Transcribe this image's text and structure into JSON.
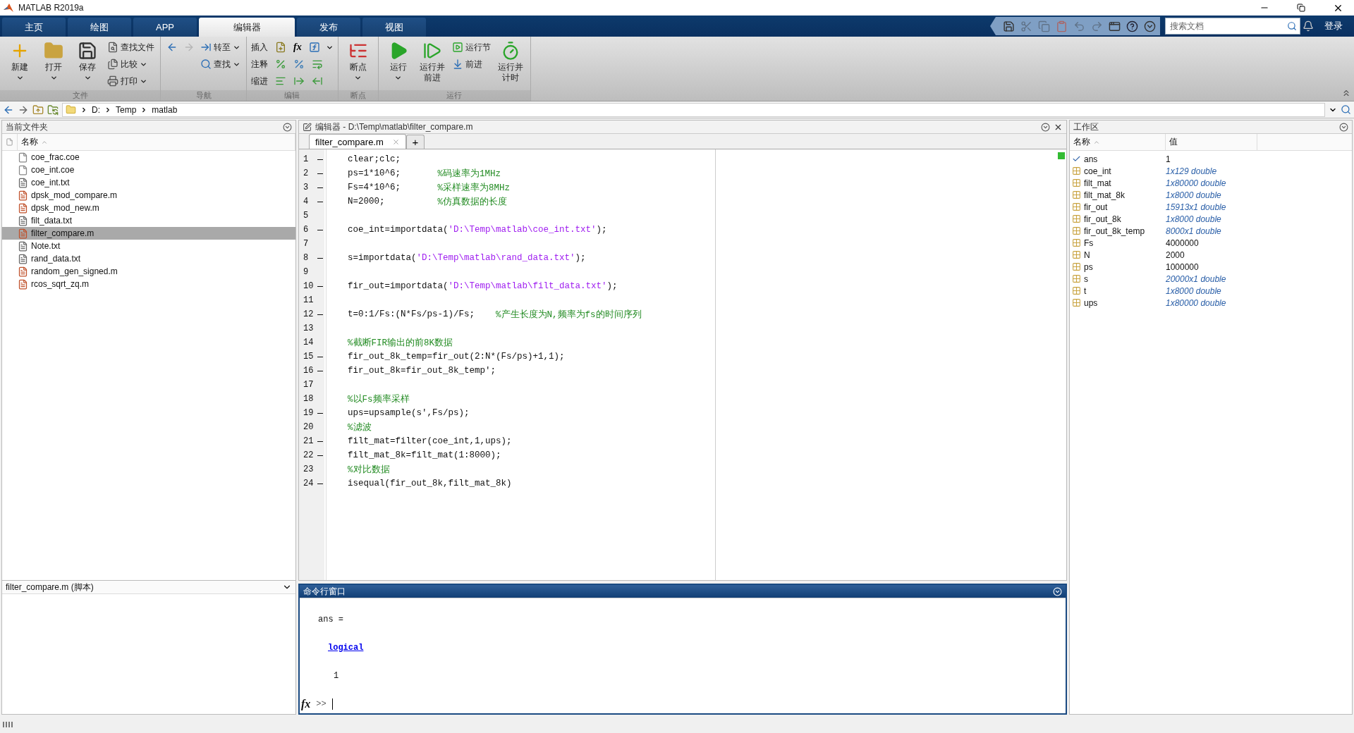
{
  "window": {
    "title": "MATLAB R2019a"
  },
  "ribbon_tabs": [
    {
      "label": "主页",
      "selected": false
    },
    {
      "label": "绘图",
      "selected": false
    },
    {
      "label": "APP",
      "selected": false
    },
    {
      "label": "编辑器",
      "selected": true
    },
    {
      "label": "发布",
      "selected": false
    },
    {
      "label": "视图",
      "selected": false
    }
  ],
  "quick_access": [
    {
      "disabled": false
    },
    {
      "disabled": true
    },
    {
      "disabled": true
    },
    {
      "disabled": false
    },
    {
      "disabled": true
    },
    {
      "disabled": true
    },
    {
      "disabled": false
    },
    {
      "disabled": false
    },
    {
      "disabled": false
    }
  ],
  "search": {
    "placeholder": "搜索文档"
  },
  "login": "登录",
  "toolstrip": [
    {
      "label": "文件",
      "items": [
        {
          "kind": "large",
          "label": "新建",
          "menu": true
        },
        {
          "kind": "large",
          "label": "打开",
          "menu": true
        },
        {
          "kind": "large",
          "label": "保存",
          "menu": true
        },
        {
          "kind": "stack",
          "buttons": [
            {
              "label": "查找文件",
              "menu": false
            },
            {
              "label": "比较",
              "menu": true
            },
            {
              "label": "打印",
              "menu": true
            }
          ]
        }
      ]
    },
    {
      "label": "导航",
      "items": [
        {
          "kind": "arrows",
          "buttons": [
            {
              "disabled": false
            },
            {
              "disabled": true
            }
          ]
        },
        {
          "kind": "stack",
          "buttons": [
            {
              "label": "转至",
              "menu": true
            },
            {
              "label": "查找",
              "menu": true
            }
          ]
        }
      ]
    },
    {
      "label": "编辑",
      "items": [
        {
          "kind": "grid",
          "rows": [
            {
              "label": "插入",
              "tools": [
                {
                  "kind": "icon"
                },
                {
                  "kind": "glyph",
                  "glyph": "fx"
                },
                {
                  "kind": "icon"
                }
              ],
              "menu": true
            },
            {
              "label": "注释",
              "tools": [
                {
                  "kind": "icon"
                },
                {
                  "kind": "icon"
                },
                {
                  "kind": "icon"
                }
              ],
              "menu": false
            },
            {
              "label": "缩进",
              "tools": [
                {
                  "kind": "icon"
                },
                {
                  "kind": "icon"
                },
                {
                  "kind": "icon"
                }
              ],
              "menu": false
            }
          ]
        }
      ]
    },
    {
      "label": "断点",
      "items": [
        {
          "kind": "large",
          "label": "断点",
          "menu": true
        }
      ]
    },
    {
      "label": "运行",
      "items": [
        {
          "kind": "large",
          "label": "运行",
          "menu": true
        },
        {
          "kind": "large",
          "label": "运行并前进",
          "menu": false
        },
        {
          "kind": "stack",
          "buttons": [
            {
              "label": "运行节",
              "menu": false
            },
            {
              "label": "前进",
              "menu": false
            }
          ]
        },
        {
          "kind": "large",
          "label": "运行并计时",
          "menu": false
        }
      ]
    }
  ],
  "address": {
    "path": [
      "D:",
      "Temp",
      "matlab"
    ]
  },
  "current_folder": {
    "title": "当前文件夹",
    "column": "名称",
    "files": [
      {
        "name": "coe_frac.coe",
        "kind": "blank",
        "selected": false
      },
      {
        "name": "coe_int.coe",
        "kind": "blank",
        "selected": false
      },
      {
        "name": "coe_int.txt",
        "kind": "text",
        "selected": false
      },
      {
        "name": "dpsk_mod_compare.m",
        "kind": "script",
        "selected": false
      },
      {
        "name": "dpsk_mod_new.m",
        "kind": "script",
        "selected": false
      },
      {
        "name": "filt_data.txt",
        "kind": "text",
        "selected": false
      },
      {
        "name": "filter_compare.m",
        "kind": "script",
        "selected": true
      },
      {
        "name": "Note.txt",
        "kind": "text",
        "selected": false
      },
      {
        "name": "rand_data.txt",
        "kind": "text",
        "selected": false
      },
      {
        "name": "random_gen_signed.m",
        "kind": "script",
        "selected": false
      },
      {
        "name": "rcos_sqrt_zq.m",
        "kind": "script",
        "selected": false
      }
    ],
    "details": "filter_compare.m  (脚本)"
  },
  "editor": {
    "title": "编辑器 - D:\\Temp\\matlab\\filter_compare.m",
    "tabs": [
      {
        "label": "filter_compare.m",
        "selected": true
      }
    ],
    "new_tab": "+",
    "lines": [
      {
        "n": "1",
        "exec": true,
        "seg": [
          {
            "kind": "code",
            "t": "clear;clc;"
          }
        ]
      },
      {
        "n": "2",
        "exec": true,
        "seg": [
          {
            "kind": "code",
            "t": "ps=1*10^6;       "
          },
          {
            "kind": "comment",
            "t": "%码速率为1MHz"
          }
        ]
      },
      {
        "n": "3",
        "exec": true,
        "seg": [
          {
            "kind": "code",
            "t": "Fs=4*10^6;       "
          },
          {
            "kind": "comment",
            "t": "%采样速率为8MHz"
          }
        ]
      },
      {
        "n": "4",
        "exec": true,
        "seg": [
          {
            "kind": "code",
            "t": "N=2000;          "
          },
          {
            "kind": "comment",
            "t": "%仿真数据的长度"
          }
        ]
      },
      {
        "n": "5",
        "exec": false
      },
      {
        "n": "6",
        "exec": true,
        "seg": [
          {
            "kind": "code",
            "t": "coe_int=importdata("
          },
          {
            "kind": "string",
            "t": "'D:\\Temp\\matlab\\coe_int.txt'"
          },
          {
            "kind": "code",
            "t": ");"
          }
        ]
      },
      {
        "n": "7",
        "exec": false
      },
      {
        "n": "8",
        "exec": true,
        "seg": [
          {
            "kind": "code",
            "t": "s=importdata("
          },
          {
            "kind": "string",
            "t": "'D:\\Temp\\matlab\\rand_data.txt'"
          },
          {
            "kind": "code",
            "t": ");"
          }
        ]
      },
      {
        "n": "9",
        "exec": false
      },
      {
        "n": "10",
        "exec": true,
        "seg": [
          {
            "kind": "code",
            "t": "fir_out=importdata("
          },
          {
            "kind": "string",
            "t": "'D:\\Temp\\matlab\\filt_data.txt'"
          },
          {
            "kind": "code",
            "t": ");"
          }
        ]
      },
      {
        "n": "11",
        "exec": false
      },
      {
        "n": "12",
        "exec": true,
        "seg": [
          {
            "kind": "code",
            "t": "t=0:1/Fs:(N*Fs/ps-1)/Fs;    "
          },
          {
            "kind": "comment",
            "t": "%产生长度为N,频率为fs的时间序列"
          }
        ]
      },
      {
        "n": "13",
        "exec": false
      },
      {
        "n": "14",
        "exec": false,
        "seg": [
          {
            "kind": "comment",
            "t": "%截断FIR输出的前8K数据"
          }
        ]
      },
      {
        "n": "15",
        "exec": true,
        "seg": [
          {
            "kind": "code",
            "t": "fir_out_8k_temp=fir_out(2:N*(Fs/ps)+1,1);"
          }
        ]
      },
      {
        "n": "16",
        "exec": true,
        "seg": [
          {
            "kind": "code",
            "t": "fir_out_8k=fir_out_8k_temp';"
          }
        ]
      },
      {
        "n": "17",
        "exec": false
      },
      {
        "n": "18",
        "exec": false,
        "seg": [
          {
            "kind": "comment",
            "t": "%以Fs频率采样"
          }
        ]
      },
      {
        "n": "19",
        "exec": true,
        "seg": [
          {
            "kind": "code",
            "t": "ups=upsample(s',Fs/ps);"
          }
        ]
      },
      {
        "n": "20",
        "exec": false,
        "seg": [
          {
            "kind": "comment",
            "t": "%滤波"
          }
        ]
      },
      {
        "n": "21",
        "exec": true,
        "seg": [
          {
            "kind": "code",
            "t": "filt_mat=filter(coe_int,1,ups);"
          }
        ]
      },
      {
        "n": "22",
        "exec": true,
        "seg": [
          {
            "kind": "code",
            "t": "filt_mat_8k=filt_mat(1:8000);"
          }
        ]
      },
      {
        "n": "23",
        "exec": false,
        "seg": [
          {
            "kind": "comment",
            "t": "%对比数据"
          }
        ]
      },
      {
        "n": "24",
        "exec": true,
        "seg": [
          {
            "kind": "code",
            "t": "isequal(fir_out_8k,filt_mat_8k)"
          }
        ]
      }
    ]
  },
  "command_window": {
    "title": "命令行窗口",
    "output": [
      {
        "kind": "text",
        "t": "ans ="
      },
      {
        "kind": "link",
        "t": "logical"
      },
      {
        "kind": "value",
        "t": "1"
      }
    ],
    "fx": "fx",
    "prompt": ">>"
  },
  "workspace": {
    "title": "工作区",
    "columns": [
      "名称",
      "值"
    ],
    "vars": [
      {
        "name": "ans",
        "value": "1",
        "kind": "logical",
        "summary": false
      },
      {
        "name": "coe_int",
        "value": "1x129 double",
        "kind": "array",
        "summary": true
      },
      {
        "name": "filt_mat",
        "value": "1x80000 double",
        "kind": "array",
        "summary": true
      },
      {
        "name": "filt_mat_8k",
        "value": "1x8000 double",
        "kind": "array",
        "summary": true
      },
      {
        "name": "fir_out",
        "value": "15913x1 double",
        "kind": "array",
        "summary": true
      },
      {
        "name": "fir_out_8k",
        "value": "1x8000 double",
        "kind": "array",
        "summary": true
      },
      {
        "name": "fir_out_8k_temp",
        "value": "8000x1 double",
        "kind": "array",
        "summary": true
      },
      {
        "name": "Fs",
        "value": "4000000",
        "kind": "array",
        "summary": false
      },
      {
        "name": "N",
        "value": "2000",
        "kind": "array",
        "summary": false
      },
      {
        "name": "ps",
        "value": "1000000",
        "kind": "array",
        "summary": false
      },
      {
        "name": "s",
        "value": "20000x1 double",
        "kind": "array",
        "summary": true
      },
      {
        "name": "t",
        "value": "1x8000 double",
        "kind": "array",
        "summary": true
      },
      {
        "name": "ups",
        "value": "1x80000 double",
        "kind": "array",
        "summary": true
      }
    ]
  }
}
